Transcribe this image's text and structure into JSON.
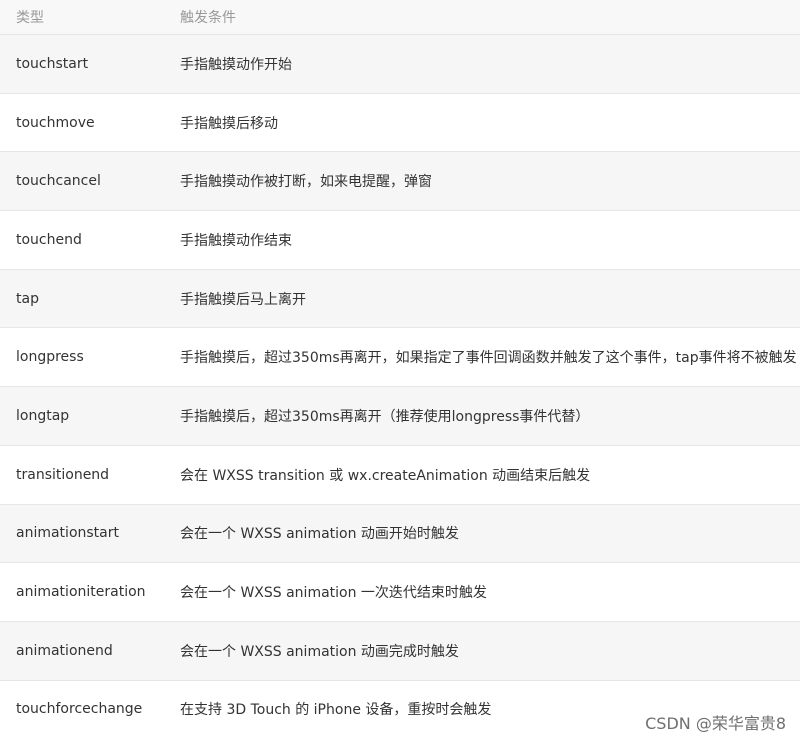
{
  "header": {
    "type_label": "类型",
    "condition_label": "触发条件"
  },
  "rows": [
    {
      "type": "touchstart",
      "condition": "手指触摸动作开始"
    },
    {
      "type": "touchmove",
      "condition": "手指触摸后移动"
    },
    {
      "type": "touchcancel",
      "condition": "手指触摸动作被打断，如来电提醒，弹窗"
    },
    {
      "type": "touchend",
      "condition": "手指触摸动作结束"
    },
    {
      "type": "tap",
      "condition": "手指触摸后马上离开"
    },
    {
      "type": "longpress",
      "condition": "手指触摸后，超过350ms再离开，如果指定了事件回调函数并触发了这个事件，tap事件将不被触发"
    },
    {
      "type": "longtap",
      "condition": "手指触摸后，超过350ms再离开（推荐使用longpress事件代替）"
    },
    {
      "type": "transitionend",
      "condition": "会在 WXSS transition 或 wx.createAnimation 动画结束后触发"
    },
    {
      "type": "animationstart",
      "condition": "会在一个 WXSS animation 动画开始时触发"
    },
    {
      "type": "animationiteration",
      "condition": "会在一个 WXSS animation 一次迭代结束时触发"
    },
    {
      "type": "animationend",
      "condition": "会在一个 WXSS animation 动画完成时触发"
    },
    {
      "type": "touchforcechange",
      "condition": "在支持 3D Touch 的 iPhone 设备，重按时会触发"
    }
  ],
  "watermark": "CSDN @荣华富贵8"
}
